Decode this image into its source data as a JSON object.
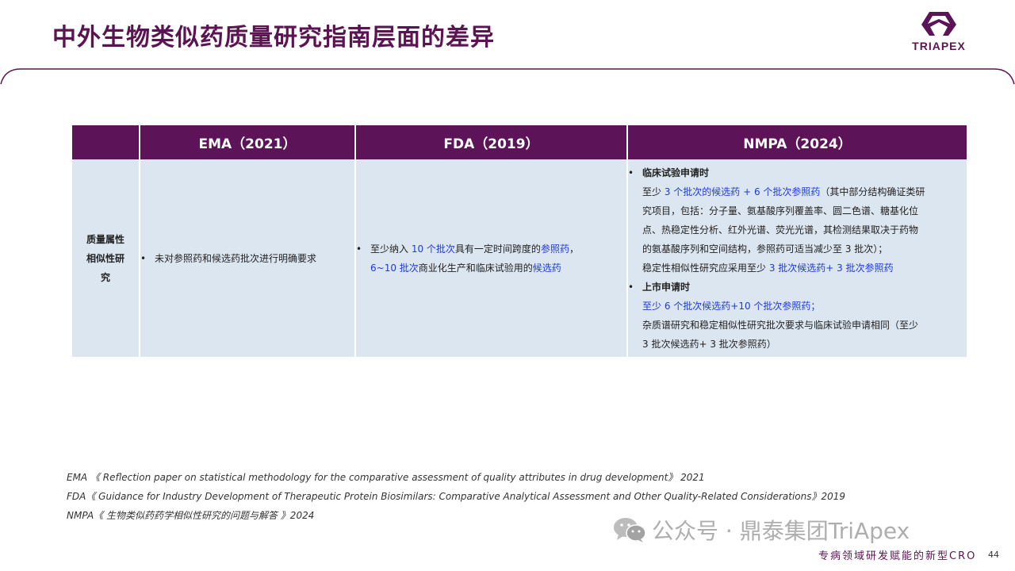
{
  "title": "中外生物类似药质量研究指南层面的差异",
  "logo_text": "TRIAPEX",
  "table": {
    "headers": [
      "",
      "EMA（2021）",
      "FDA（2019）",
      "NMPA（2024）"
    ],
    "row_label_lines": [
      "质量属性",
      "相似性研",
      "究"
    ],
    "ema_text": "未对参照药和候选药批次进行明确要求",
    "fda": {
      "l1_a": "至少纳入 ",
      "l1_b": "10 个批次",
      "l1_c": "具有一定时间跨度的",
      "l1_d": "参照药",
      "l1_e": "，",
      "l2_a": "6~10 批次",
      "l2_b": "商业化生产和临床试验用的",
      "l2_c": "候选药"
    },
    "nmpa": {
      "clinical_heading": "临床试验申请时",
      "c1_a": "至少 ",
      "c1_b": "3 个批次的候选药 + 6 个批次参照药",
      "c1_c": "（其中部分结构确证类研",
      "c2": "究项目，包括：分子量、氨基酸序列覆盖率、圆二色谱、糖基化位",
      "c3": "点、热稳定性分析、红外光谱、荧光光谱，其检测结果取决于药物",
      "c4": "的氨基酸序列和空间结构，参照药可适当减少至 3 批次）；",
      "c5_a": "稳定性相似性研究应采用至少 ",
      "c5_b": "3 批次候选药+  3 批次参照药",
      "market_heading": "上市申请时",
      "m1": "至少 6 个批次候选药+10 个批次参照药；",
      "m2": "杂质谱研究和稳定相似性研究批次要求与临床试验申请相同（至少",
      "m3": "3 批次候选药+  3 批次参照药）"
    }
  },
  "references": [
    "EMA 《 Reflection paper on statistical methodology for the comparative assessment of quality attributes in drug development》 2021",
    "FDA《 Guidance for Industry Development of Therapeutic Protein Biosimilars: Comparative Analytical Assessment and Other Quality-Related Considerations》2019",
    "NMPA《 生物类似药药学相似性研究的问题与解答 》2024"
  ],
  "watermark": "公众号 · 鼎泰集团TriApex",
  "footer_slogan": "专病领域研发赋能的新型CRO",
  "page_number": "44",
  "colors": {
    "brand_purple": "#5c1358",
    "cell_blue": "#dce6f1",
    "highlight_blue": "#1f3ccf"
  }
}
